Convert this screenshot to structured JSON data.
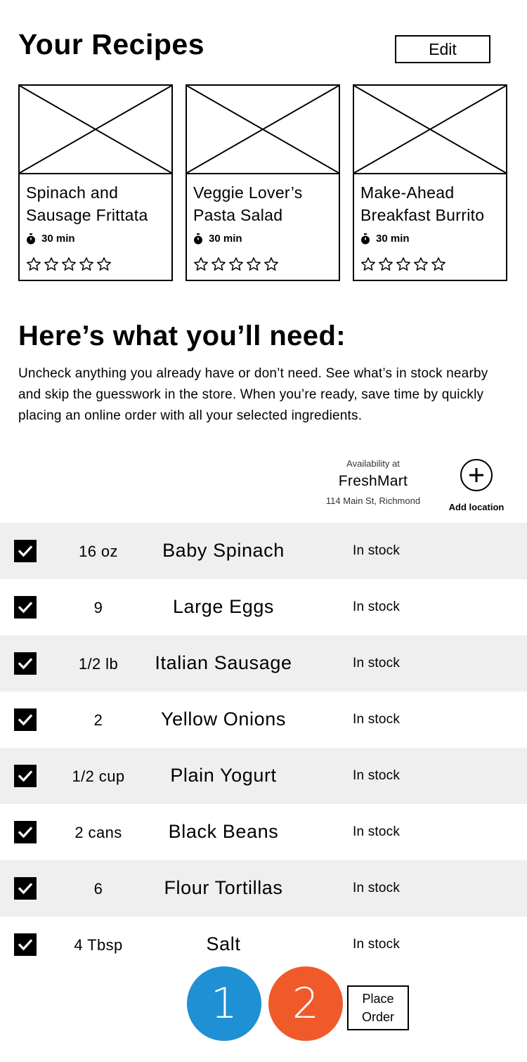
{
  "header": {
    "title": "Your Recipes",
    "edit_label": "Edit"
  },
  "recipes": [
    {
      "name": "Spinach and Sausage Frittata",
      "time": "30 min",
      "rating": 0,
      "max_rating": 5
    },
    {
      "name": "Veggie Lover’s Pasta Salad",
      "time": "30 min",
      "rating": 0,
      "max_rating": 5
    },
    {
      "name": "Make-Ahead Breakfast Burrito",
      "time": "30 min",
      "rating": 0,
      "max_rating": 5
    }
  ],
  "needs": {
    "title": "Here’s what you’ll need:",
    "instructions": "Uncheck anything you already have or don’t need.  See what’s in stock nearby and skip the guesswork in the store.  When you’re ready, save time by quickly placing an online order with all your selected ingredients."
  },
  "availability": {
    "label": "Availability at",
    "store_name": "FreshMart",
    "address": "114 Main St, Richmond",
    "add_location_label": "Add location"
  },
  "ingredients": [
    {
      "checked": true,
      "quantity": "16 oz",
      "name": "Baby Spinach",
      "status": "In stock"
    },
    {
      "checked": true,
      "quantity": "9",
      "name": "Large Eggs",
      "status": "In stock"
    },
    {
      "checked": true,
      "quantity": "1/2 lb",
      "name": "Italian Sausage",
      "status": "In stock"
    },
    {
      "checked": true,
      "quantity": "2",
      "name": "Yellow Onions",
      "status": "In stock"
    },
    {
      "checked": true,
      "quantity": "1/2 cup",
      "name": "Plain Yogurt",
      "status": "In stock"
    },
    {
      "checked": true,
      "quantity": "2 cans",
      "name": "Black Beans",
      "status": "In stock"
    },
    {
      "checked": true,
      "quantity": "6",
      "name": "Flour Tortillas",
      "status": "In stock"
    },
    {
      "checked": true,
      "quantity": "4 Tbsp",
      "name": "Salt",
      "status": "In stock"
    }
  ],
  "footer": {
    "badge_1": "1",
    "badge_2": "2",
    "place_order_label": "Place Order"
  },
  "colors": {
    "badge_1": "#1e90d3",
    "badge_2": "#f05a2a",
    "row_shade": "#efefef"
  },
  "icons": {
    "thumbnail": "image-placeholder-icon",
    "time": "stopwatch-icon",
    "rating": "star-outline-icon",
    "checkbox": "checkmark-icon",
    "add_location": "plus-circle-icon"
  }
}
